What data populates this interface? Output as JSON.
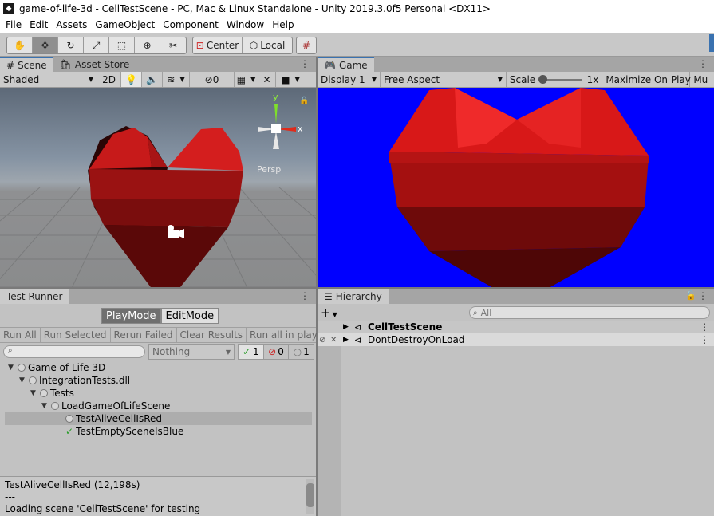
{
  "window": {
    "title": "game-of-life-3d - CellTestScene - PC, Mac & Linux Standalone - Unity 2019.3.0f5 Personal <DX11>"
  },
  "menu": [
    "File",
    "Edit",
    "Assets",
    "GameObject",
    "Component",
    "Window",
    "Help"
  ],
  "toolbar": {
    "tools": [
      "hand-tool",
      "move-tool",
      "rotate-tool",
      "scale-tool",
      "rect-tool",
      "transform-tool",
      "custom-tool"
    ],
    "active_tool": "move-tool",
    "pivot_label": "Center",
    "space_label": "Local"
  },
  "scene": {
    "tabs": [
      "Scene",
      "Asset Store"
    ],
    "shading": "Shaded",
    "mode_2d": "2D",
    "hidden_count": "0",
    "gizmo_label": "Persp",
    "axis_y": "y",
    "axis_x": "x"
  },
  "game": {
    "tab": "Game",
    "display": "Display 1",
    "aspect": "Free Aspect",
    "scale_label": "Scale",
    "scale_value": "1x",
    "maximize": "Maximize On Play",
    "mute": "Mu",
    "background_color": "#0000ff"
  },
  "runner": {
    "tab": "Test Runner",
    "modes": {
      "play": "PlayMode",
      "edit": "EditMode"
    },
    "buttons": [
      "Run All",
      "Run Selected",
      "Rerun Failed",
      "Clear Results",
      "Run all in player"
    ],
    "filter": "Nothing",
    "counts": {
      "passed": "1",
      "failed": "0",
      "skipped": "1"
    },
    "tree": [
      {
        "label": "Game of Life 3D",
        "depth": 0,
        "expanded": true,
        "status": "none"
      },
      {
        "label": "IntegrationTests.dll",
        "depth": 1,
        "expanded": true,
        "status": "none"
      },
      {
        "label": "Tests",
        "depth": 2,
        "expanded": true,
        "status": "none"
      },
      {
        "label": "LoadGameOfLifeScene",
        "depth": 3,
        "expanded": true,
        "status": "none"
      },
      {
        "label": "TestAliveCellIsRed",
        "depth": 4,
        "status": "none",
        "selected": true
      },
      {
        "label": "TestEmptySceneIsBlue",
        "depth": 4,
        "status": "passed"
      }
    ],
    "log": [
      "TestAliveCellIsRed (12,198s)",
      "---",
      "Loading scene 'CellTestScene' for testing"
    ]
  },
  "hierarchy": {
    "tab": "Hierarchy",
    "search_placeholder": "All",
    "add_label": "+",
    "items": [
      {
        "label": "CellTestScene",
        "bold": true
      },
      {
        "label": "DontDestroyOnLoad",
        "bold": false
      }
    ]
  }
}
